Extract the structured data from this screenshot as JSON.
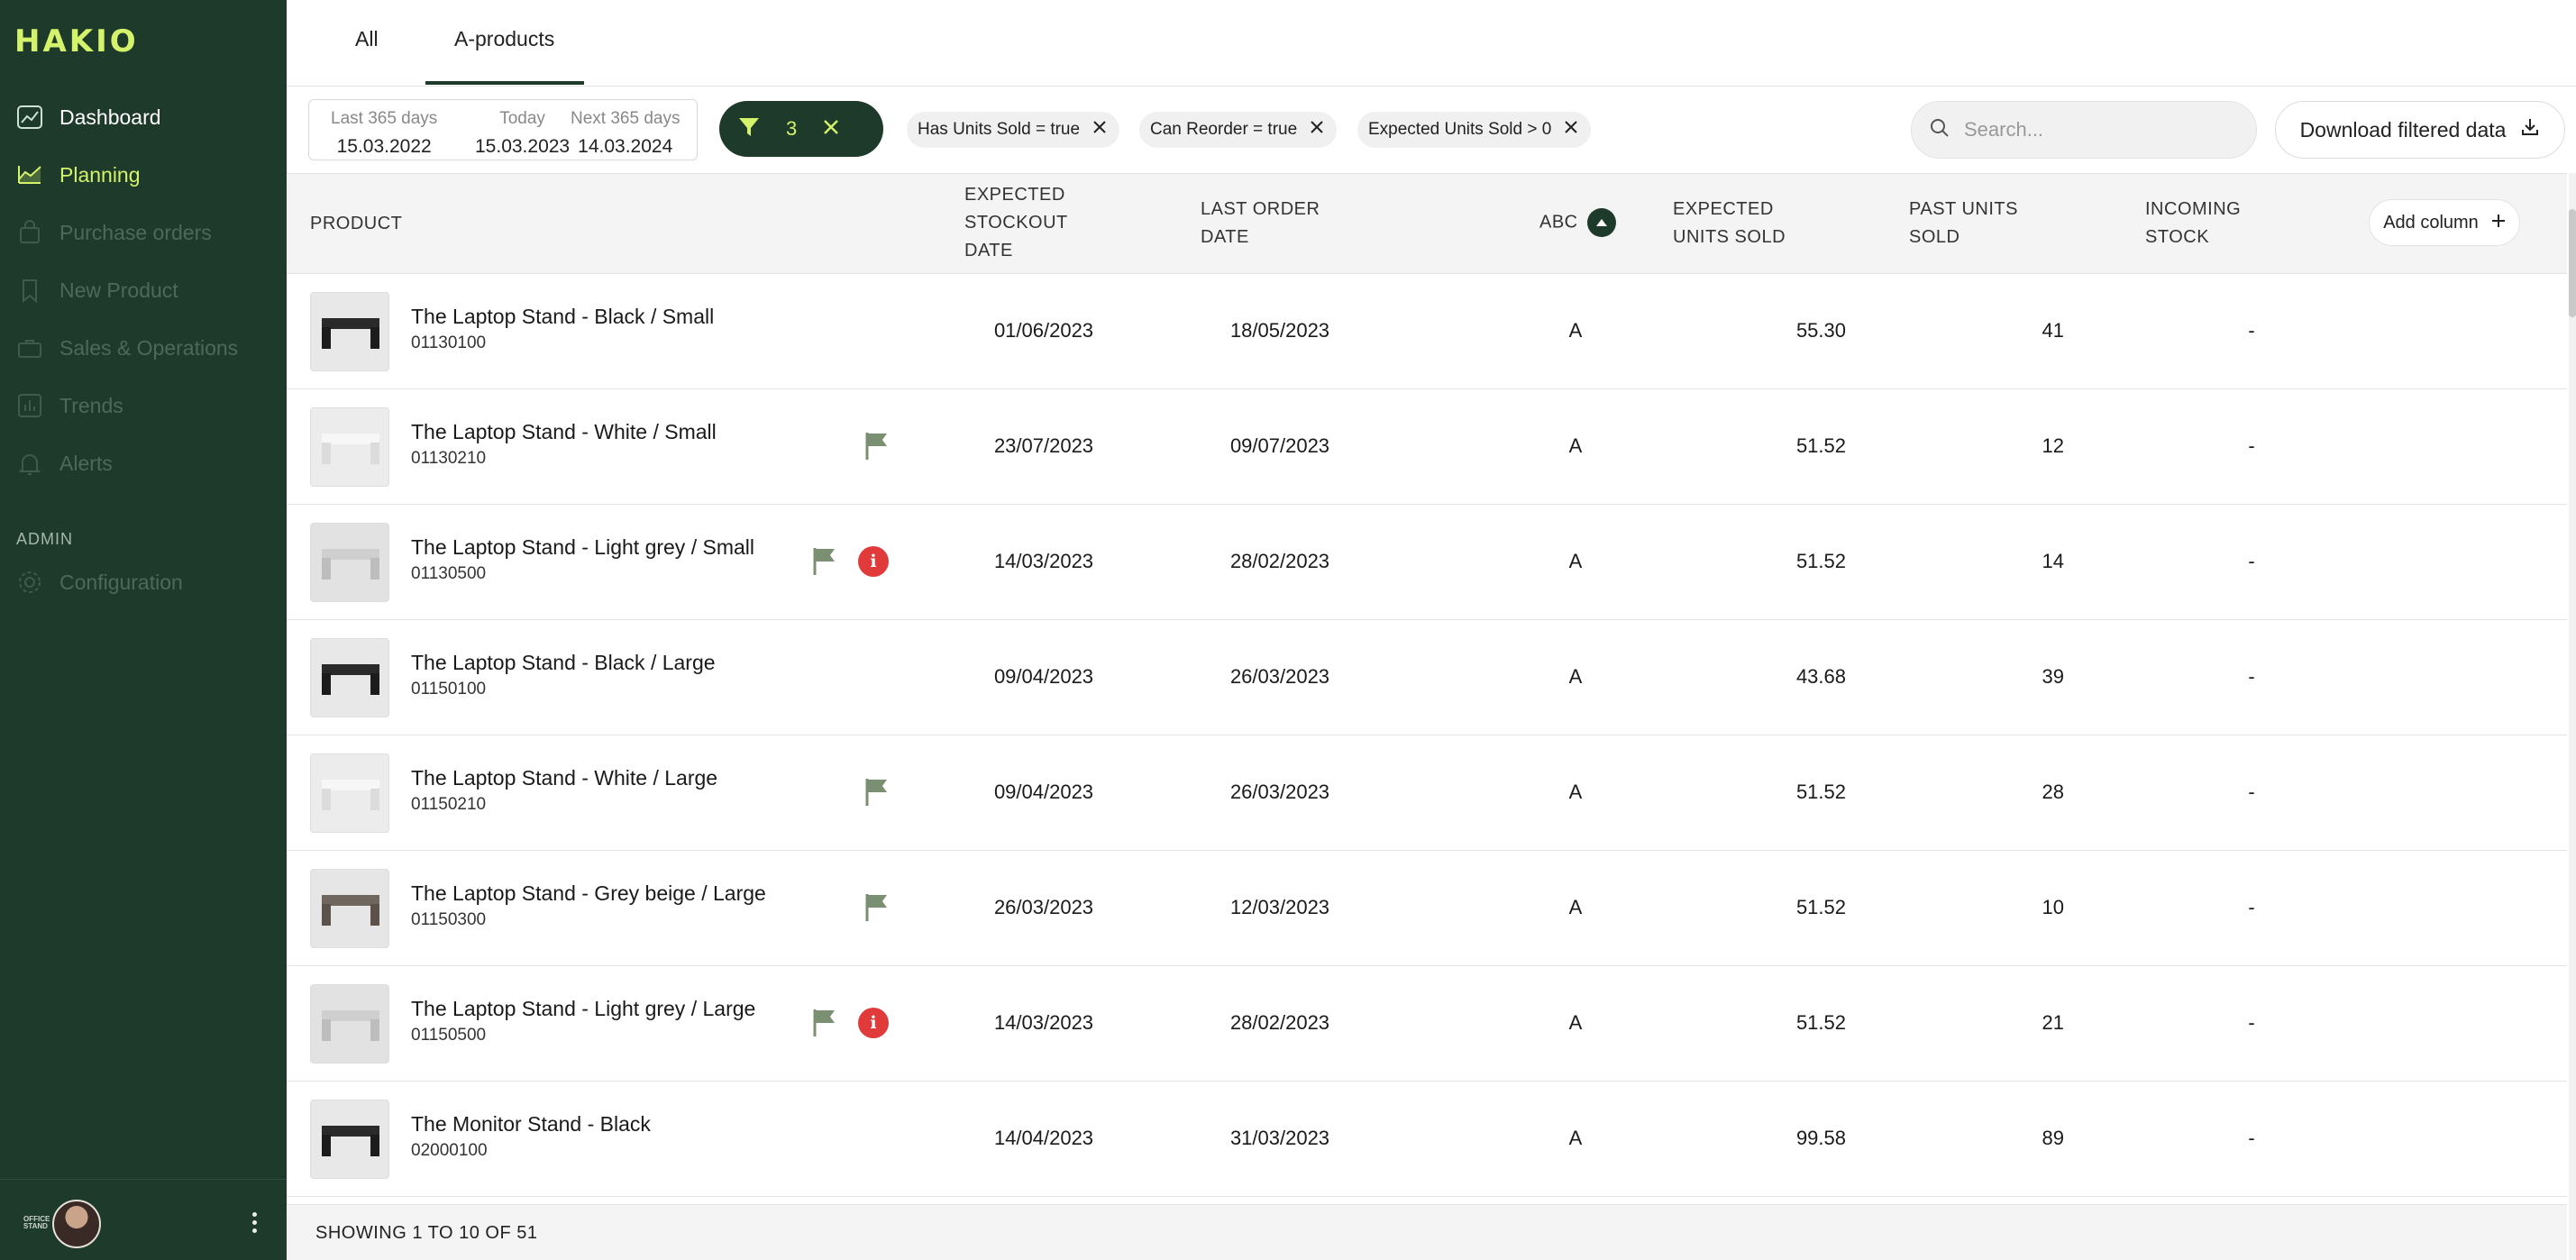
{
  "app": {
    "logo": "HAKIO"
  },
  "sidebar": {
    "items": [
      {
        "label": "Dashboard",
        "icon": "trend-chart-icon",
        "state": "primary"
      },
      {
        "label": "Planning",
        "icon": "area-chart-icon",
        "state": "active"
      },
      {
        "label": "Purchase orders",
        "icon": "shopping-bag-icon",
        "state": "disabled"
      },
      {
        "label": "New Product",
        "icon": "bookmark-icon",
        "state": "disabled"
      },
      {
        "label": "Sales & Operations",
        "icon": "briefcase-icon",
        "state": "disabled"
      },
      {
        "label": "Trends",
        "icon": "bar-chart-icon",
        "state": "disabled"
      },
      {
        "label": "Alerts",
        "icon": "bell-icon",
        "state": "disabled"
      }
    ],
    "admin_label": "ADMIN",
    "admin_items": [
      {
        "label": "Configuration",
        "icon": "gear-icon",
        "state": "disabled"
      }
    ],
    "footer": {
      "brand_mini": "OFFICE STAND",
      "menu_icon": "kebab-menu-icon"
    }
  },
  "tabs": [
    {
      "label": "All",
      "active": false
    },
    {
      "label": "A-products",
      "active": true
    }
  ],
  "date_range": {
    "last": {
      "caption": "Last 365 days",
      "value": "15.03.2022"
    },
    "today": {
      "caption": "Today",
      "value": "15.03.2023"
    },
    "next": {
      "caption": "Next 365 days",
      "value": "14.03.2024"
    }
  },
  "filter_summary": {
    "count": "3"
  },
  "filter_chips": [
    "Has Units Sold = true",
    "Can Reorder = true",
    "Expected Units Sold > 0"
  ],
  "search": {
    "placeholder": "Search..."
  },
  "download_label": "Download filtered data",
  "table": {
    "headers": {
      "product": "PRODUCT",
      "stockout_1": "EXPECTED",
      "stockout_2": "STOCKOUT",
      "stockout_3": "DATE",
      "last_order_1": "LAST ORDER",
      "last_order_2": "DATE",
      "abc": "ABC",
      "exp_sold_1": "EXPECTED",
      "exp_sold_2": "UNITS SOLD",
      "past_sold_1": "PAST UNITS",
      "past_sold_2": "SOLD",
      "incoming_1": "INCOMING",
      "incoming_2": "STOCK"
    },
    "add_column_label": "Add column",
    "rows": [
      {
        "name": "The Laptop Stand - Black / Small",
        "sku": "01130100",
        "color": "black",
        "flag": false,
        "alert": false,
        "stockout": "01/06/2023",
        "last_order": "18/05/2023",
        "abc": "A",
        "expected_units": "55.30",
        "past_units": "41",
        "incoming": "-"
      },
      {
        "name": "The Laptop Stand - White / Small",
        "sku": "01130210",
        "color": "white",
        "flag": true,
        "alert": false,
        "stockout": "23/07/2023",
        "last_order": "09/07/2023",
        "abc": "A",
        "expected_units": "51.52",
        "past_units": "12",
        "incoming": "-"
      },
      {
        "name": "The Laptop Stand - Light grey / Small",
        "sku": "01130500",
        "color": "lightgrey",
        "flag": true,
        "alert": true,
        "stockout": "14/03/2023",
        "last_order": "28/02/2023",
        "abc": "A",
        "expected_units": "51.52",
        "past_units": "14",
        "incoming": "-"
      },
      {
        "name": "The Laptop Stand - Black / Large",
        "sku": "01150100",
        "color": "black",
        "flag": false,
        "alert": false,
        "stockout": "09/04/2023",
        "last_order": "26/03/2023",
        "abc": "A",
        "expected_units": "43.68",
        "past_units": "39",
        "incoming": "-"
      },
      {
        "name": "The Laptop Stand - White / Large",
        "sku": "01150210",
        "color": "white",
        "flag": true,
        "alert": false,
        "stockout": "09/04/2023",
        "last_order": "26/03/2023",
        "abc": "A",
        "expected_units": "51.52",
        "past_units": "28",
        "incoming": "-"
      },
      {
        "name": "The Laptop Stand - Grey beige / Large",
        "sku": "01150300",
        "color": "greybeige",
        "flag": true,
        "alert": false,
        "stockout": "26/03/2023",
        "last_order": "12/03/2023",
        "abc": "A",
        "expected_units": "51.52",
        "past_units": "10",
        "incoming": "-"
      },
      {
        "name": "The Laptop Stand - Light grey / Large",
        "sku": "01150500",
        "color": "lightgrey",
        "flag": true,
        "alert": true,
        "stockout": "14/03/2023",
        "last_order": "28/02/2023",
        "abc": "A",
        "expected_units": "51.52",
        "past_units": "21",
        "incoming": "-"
      },
      {
        "name": "The Monitor Stand - Black",
        "sku": "02000100",
        "color": "black",
        "flag": false,
        "alert": false,
        "stockout": "14/04/2023",
        "last_order": "31/03/2023",
        "abc": "A",
        "expected_units": "99.58",
        "past_units": "89",
        "incoming": "-"
      }
    ]
  },
  "footer": {
    "showing": "SHOWING 1 TO 10 OF 51"
  },
  "colors": {
    "sidebar_bg": "#1d3a2b",
    "accent": "#d4f26a",
    "flag": "#7b8f72",
    "alert": "#e03a3a"
  }
}
